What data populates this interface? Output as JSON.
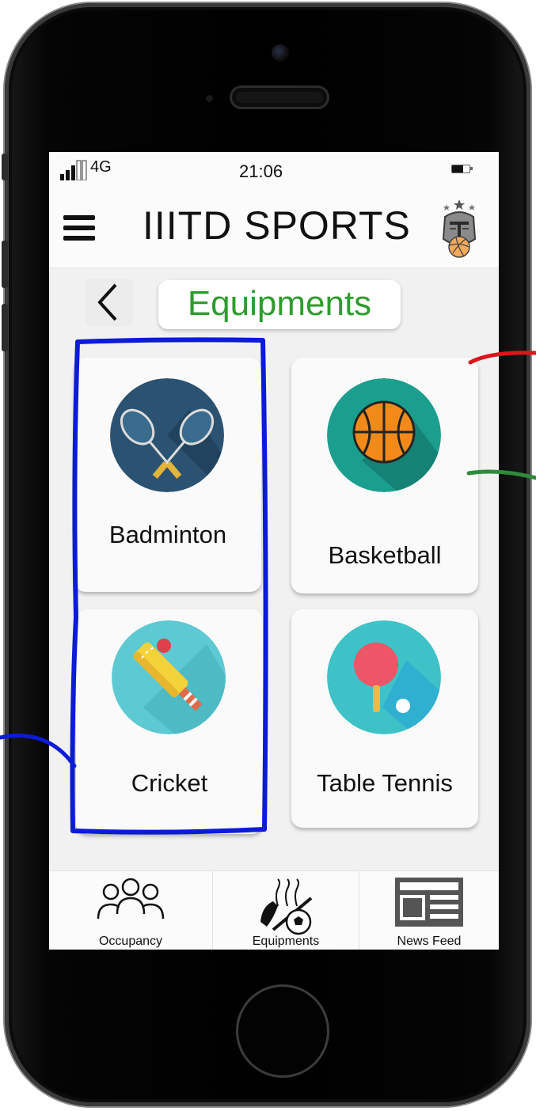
{
  "status_bar": {
    "network": "4G",
    "time": "21:06"
  },
  "header": {
    "title": "IIITD SPORTS"
  },
  "section": {
    "title": "Equipments"
  },
  "sports": [
    {
      "label": "Badminton",
      "icon": "badminton-rackets-icon"
    },
    {
      "label": "Basketball",
      "icon": "basketball-icon"
    },
    {
      "label": "Cricket",
      "icon": "cricket-bat-ball-icon"
    },
    {
      "label": "Table Tennis",
      "icon": "table-tennis-paddle-icon"
    }
  ],
  "bottom_nav": [
    {
      "label": "Occupancy",
      "icon": "people-group-icon"
    },
    {
      "label": "Equipments",
      "icon": "sports-equipment-icon"
    },
    {
      "label": "News Feed",
      "icon": "newspaper-icon"
    }
  ],
  "colors": {
    "section_title": "#2e9c2e",
    "badminton_bg": "#2b5271",
    "basketball_bg": "#1c9e8f",
    "cricket_bg": "#5cc9d3",
    "table_tennis_bg": "#3ec2c7",
    "annotation_red": "#e0141b",
    "annotation_green": "#2f8a3a",
    "annotation_blue": "#0b1bd6"
  }
}
